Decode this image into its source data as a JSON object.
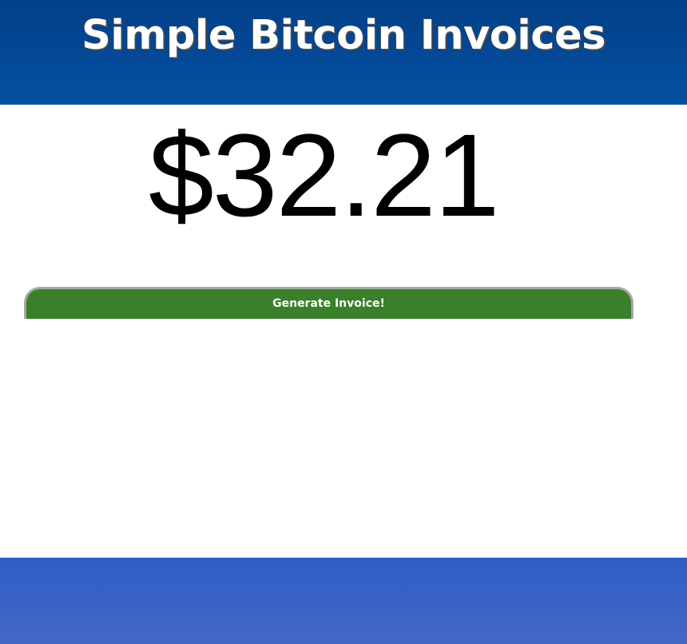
{
  "header": {
    "title": "Simple Bitcoin Invoices"
  },
  "main": {
    "amount": "$32.21",
    "generate_button_label": "Generate Invoice!"
  },
  "colors": {
    "header_blue": "#0450a4",
    "button_green": "#3a7f2a",
    "footer_blue": "#3862c6"
  }
}
